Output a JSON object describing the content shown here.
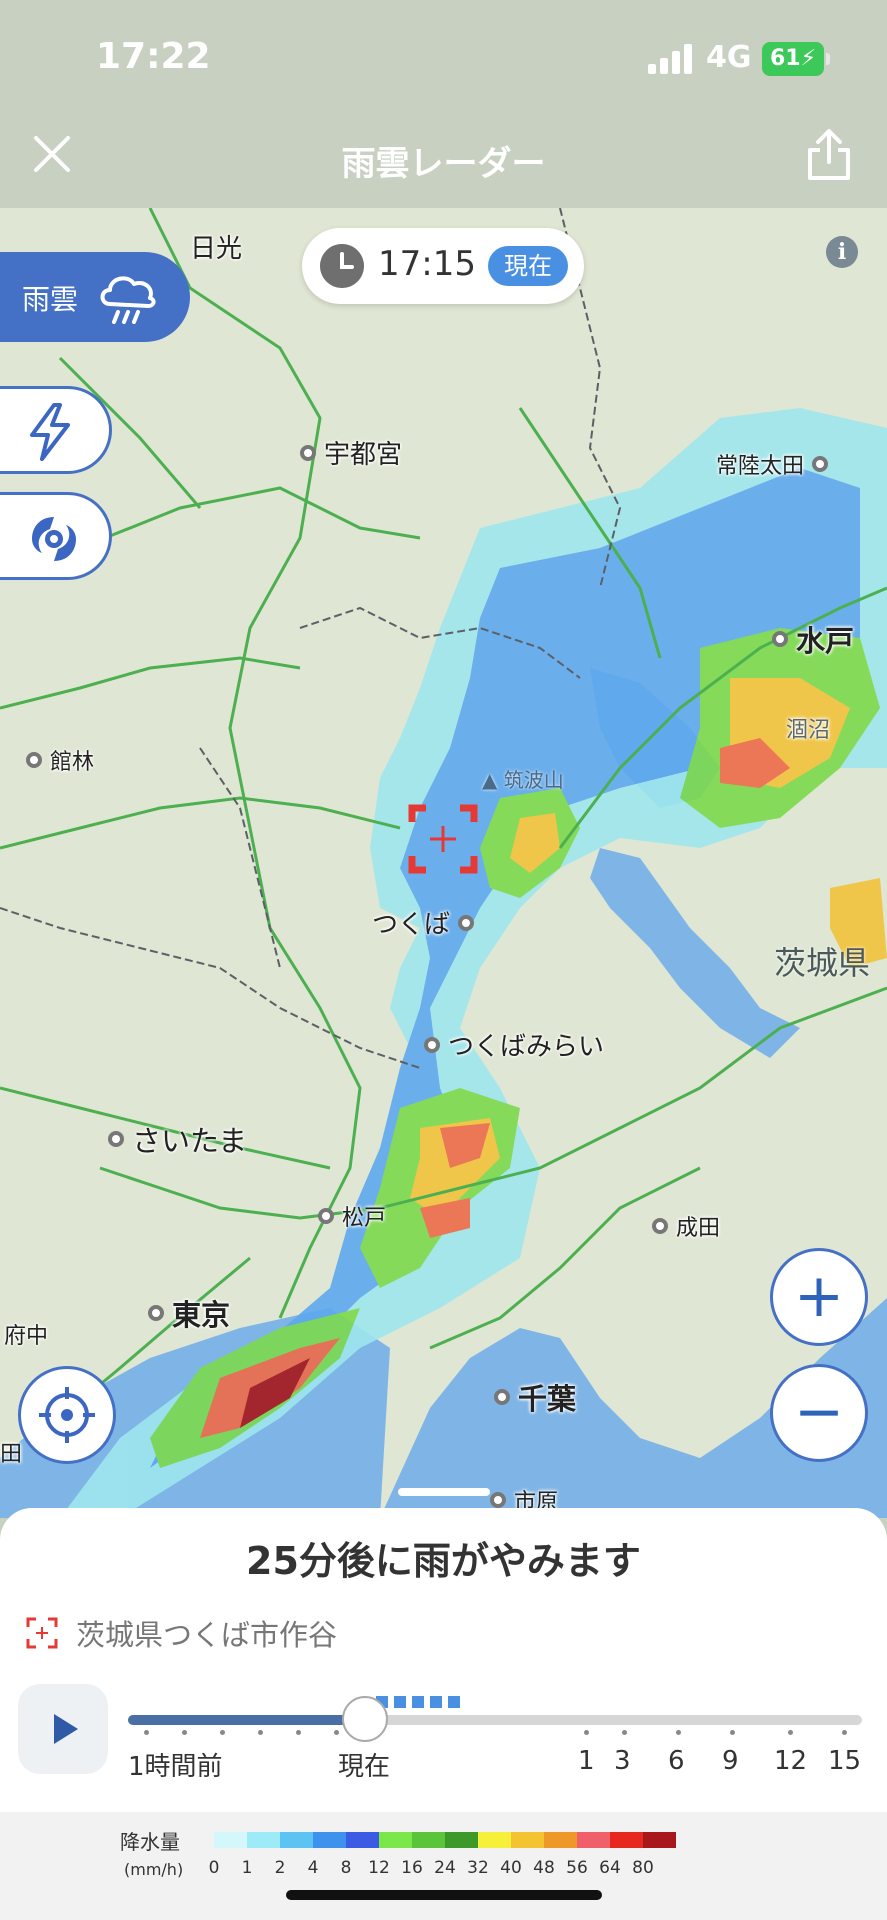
{
  "status": {
    "time": "17:22",
    "network": "4G",
    "battery": "61"
  },
  "header": {
    "title": "雨雲レーダー",
    "close_icon": "close-icon",
    "share_icon": "share-icon"
  },
  "map": {
    "time_label": "17:15",
    "now_badge": "現在",
    "info_label": "i",
    "layer_active_label": "雨雲",
    "cities": [
      {
        "name": "日光"
      },
      {
        "name": "宇都宮"
      },
      {
        "name": "常陸太田"
      },
      {
        "name": "水戸"
      },
      {
        "name": "館林"
      },
      {
        "name": "つくば"
      },
      {
        "name": "つくばみらい"
      },
      {
        "name": "さいたま"
      },
      {
        "name": "松戸"
      },
      {
        "name": "成田"
      },
      {
        "name": "東京"
      },
      {
        "name": "府中"
      },
      {
        "name": "千葉"
      },
      {
        "name": "市原"
      },
      {
        "name": "田"
      }
    ],
    "labels": {
      "mountain": "筑波山",
      "lake": "涸沼",
      "prefecture": "茨城県"
    },
    "zoom_in": "+",
    "zoom_out": "−"
  },
  "sheet": {
    "headline": "25分後に雨がやみます",
    "location": "茨城県つくば市作谷",
    "timeline_labels": [
      "1時間前",
      "現在",
      "1",
      "3",
      "6",
      "9",
      "12",
      "15"
    ],
    "playback_position_fraction": 0.32
  },
  "legend": {
    "title": "降水量",
    "unit": "(mm/h)",
    "values": [
      "0",
      "1",
      "2",
      "4",
      "8",
      "12",
      "16",
      "24",
      "32",
      "40",
      "48",
      "56",
      "64",
      "80"
    ],
    "colors": [
      "#d4f7fb",
      "#9cebf7",
      "#5cc3f2",
      "#3f91ee",
      "#3b5be4",
      "#7ae84a",
      "#5ac53a",
      "#3d9a2a",
      "#f6f03a",
      "#f3c332",
      "#ee982a",
      "#f0606a",
      "#e6281e",
      "#a8171c"
    ]
  }
}
